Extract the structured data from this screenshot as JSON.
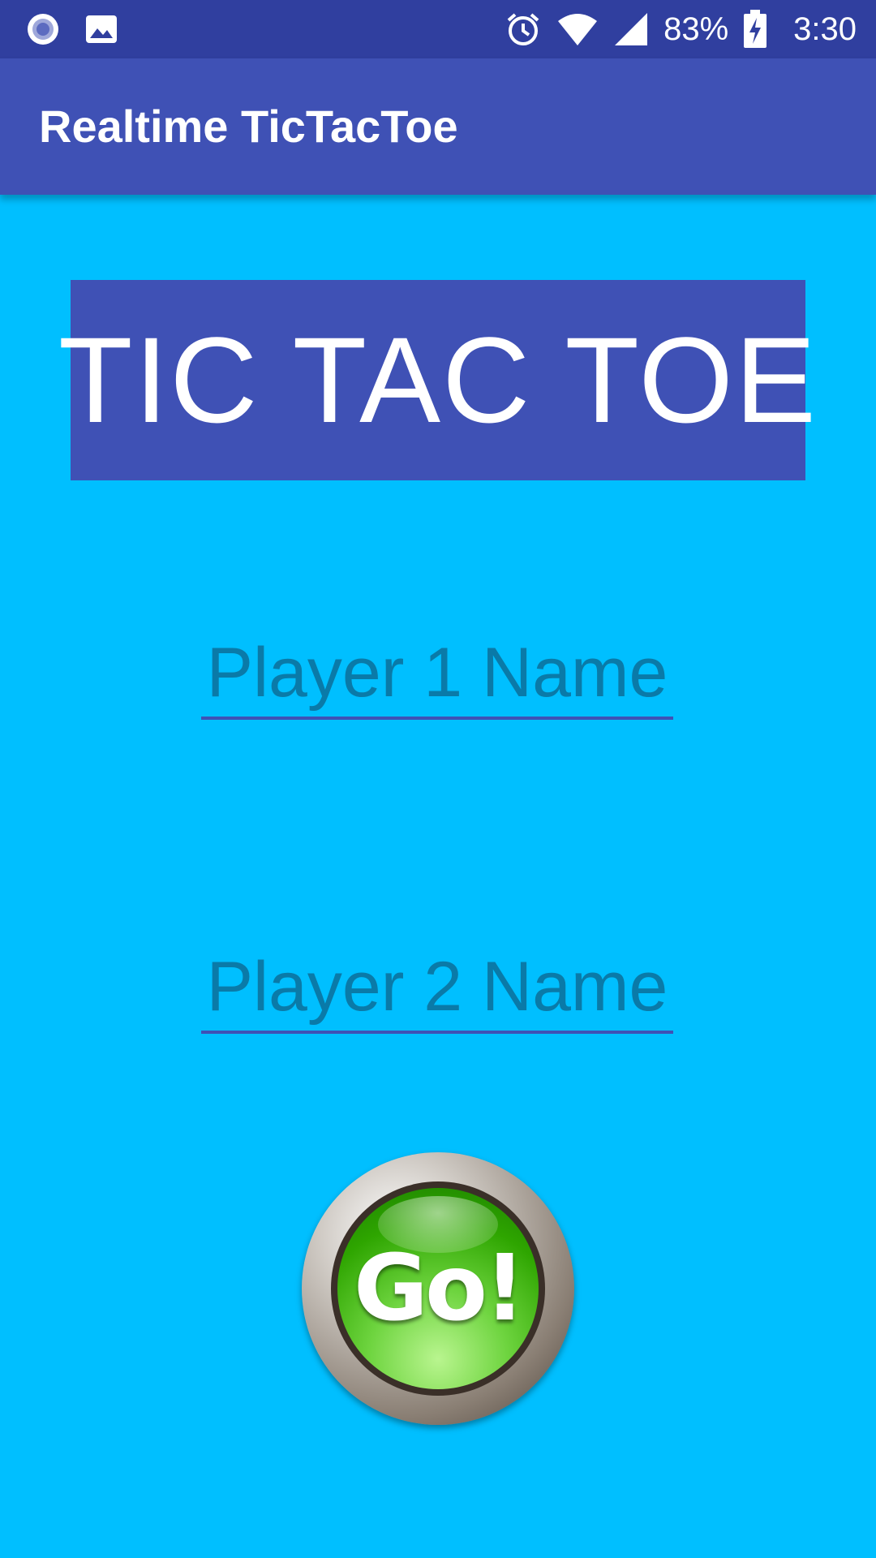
{
  "status_bar": {
    "battery_percent": "83%",
    "time": "3:30",
    "icons": [
      "notification-circle-icon",
      "image-icon",
      "alarm-icon",
      "wifi-icon",
      "cell-signal-icon",
      "battery-charging-icon"
    ]
  },
  "app_bar": {
    "title": "Realtime TicTacToe"
  },
  "banner": {
    "title": "TIC TAC TOE"
  },
  "form": {
    "player1_placeholder": "Player 1 Name",
    "player1_value": "",
    "player2_placeholder": "Player 2 Name",
    "player2_value": "",
    "go_label": "Go!"
  },
  "colors": {
    "background": "#00bfff",
    "status_bar": "#303f9f",
    "primary": "#3f51b5",
    "go_green": "#2ea500"
  }
}
